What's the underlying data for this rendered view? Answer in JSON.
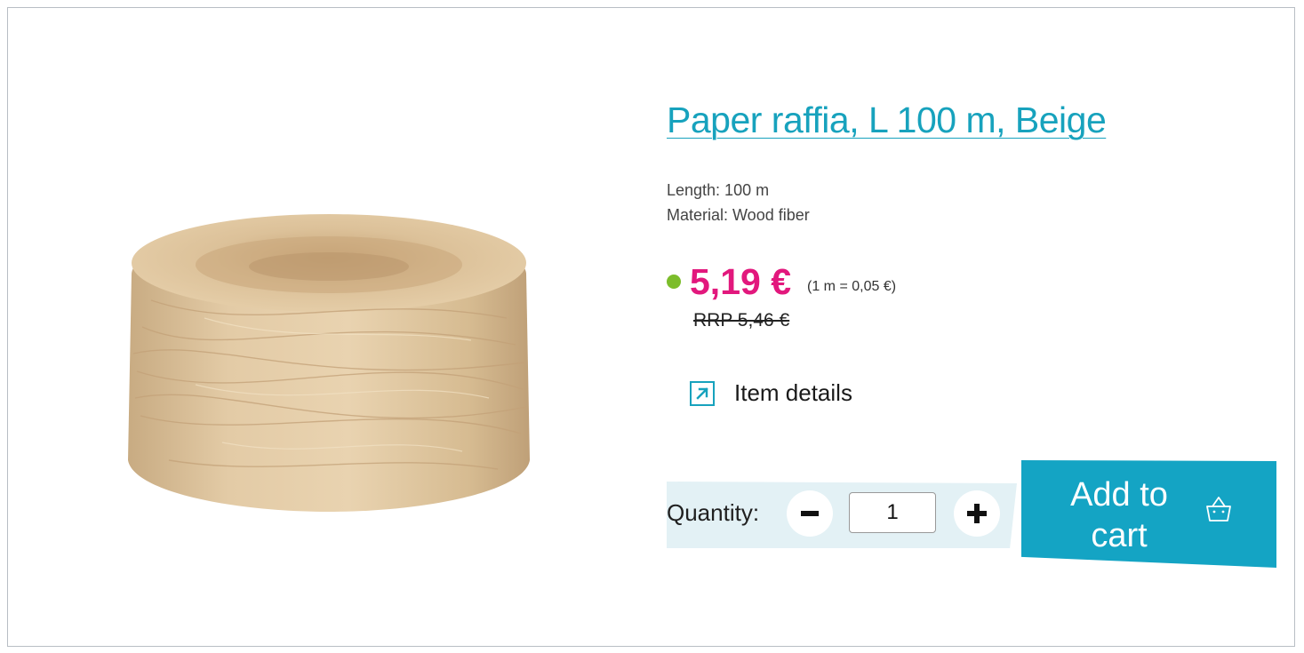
{
  "product": {
    "title": "Paper raffia, L 100 m, Beige",
    "specs": [
      "Length: 100 m",
      "Material: Wood fiber"
    ],
    "price": "5,19 €",
    "unit_price": "(1 m = 0,05 €)",
    "rrp": "RRP 5,46 €",
    "availability_color": "#7cbd2b"
  },
  "details_link": {
    "label": "Item details"
  },
  "quantity": {
    "label": "Quantity:",
    "value": "1"
  },
  "cart": {
    "line1": "Add to",
    "line2": "cart"
  },
  "colors": {
    "accent": "#17a2bd",
    "price": "#e2187d",
    "button": "#14a4c4",
    "quantity_band": "#e3f1f5"
  }
}
